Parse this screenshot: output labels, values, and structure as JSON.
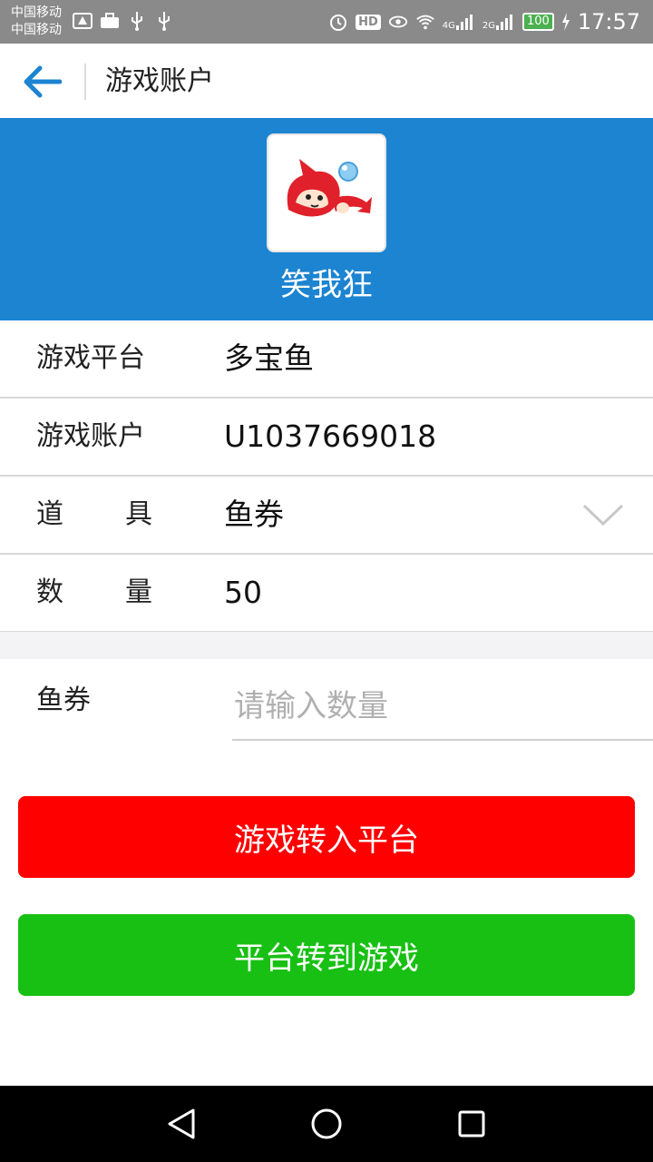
{
  "status_bar": {
    "carrier_1": "中国移动",
    "carrier_2": "中国移动",
    "left_icons": [
      "huawei-icon",
      "briefcase-icon",
      "usb-icon",
      "usb-icon"
    ],
    "hd_label": "HD",
    "net_4g": "4G",
    "net_2g": "2G",
    "battery": "100",
    "time": "17:57"
  },
  "nav": {
    "title": "游戏账户"
  },
  "header": {
    "game_name": "笑我狂",
    "background_color": "#1c84d1"
  },
  "info": {
    "platform_label": "游戏平台",
    "platform_value": "多宝鱼",
    "account_label": "游戏账户",
    "account_value": "U1037669018",
    "item_label_1": "道",
    "item_label_2": "具",
    "item_value": "鱼券",
    "quantity_label_1": "数",
    "quantity_label_2": "量",
    "quantity_value": "50"
  },
  "transfer": {
    "input_label": "鱼券",
    "input_placeholder": "请输入数量",
    "game_to_platform": "游戏转入平台",
    "platform_to_game": "平台转到游戏"
  },
  "colors": {
    "accent_blue": "#1c84d1",
    "button_red": "#fe0000",
    "button_green": "#18c014"
  }
}
